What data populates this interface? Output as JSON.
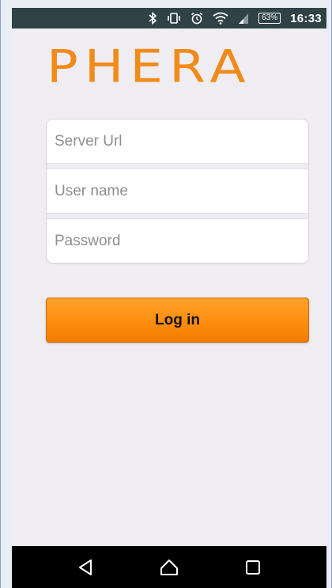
{
  "status_bar": {
    "icons": [
      "bluetooth-icon",
      "vibrate-icon",
      "alarm-icon",
      "wifi-icon",
      "signal-icon",
      "battery-icon"
    ],
    "battery_percent": "63%",
    "time": "16:33",
    "background": "#2f4245"
  },
  "app": {
    "logo_text": "PHERA",
    "brand_color": "#f28a1a"
  },
  "login_form": {
    "server_url_placeholder": "Server Url",
    "server_url_value": "",
    "username_placeholder": "User name",
    "username_value": "",
    "password_placeholder": "Password",
    "password_value": "",
    "login_label": "Log in"
  },
  "nav_bar": {
    "icons": [
      "back-icon",
      "home-icon",
      "recents-icon"
    ]
  }
}
